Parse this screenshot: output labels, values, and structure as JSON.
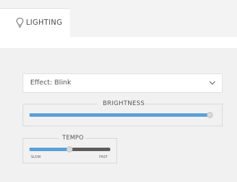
{
  "tabs": {
    "active": {
      "icon": "lightbulb-icon",
      "label": "LIGHTING"
    }
  },
  "effect": {
    "selected": "Effect: Blink",
    "chevron_icon": "chevron-down-icon"
  },
  "brightness": {
    "label": "BRIGHTNESS",
    "level": 0.99
  },
  "tempo": {
    "label": "TEMPO",
    "level": 0.49,
    "min_label": "SLOW",
    "max_label": "FAST"
  },
  "colors": {
    "accent": "#5aa0d8",
    "track": "#5c5c5c",
    "background": "#f1f1f1"
  }
}
